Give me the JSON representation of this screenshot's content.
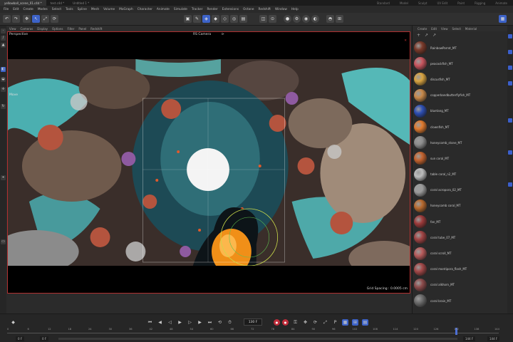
{
  "doc_tabs": [
    "yellowball_scene_01.c4d *",
    "test.c4d *",
    "Untitled 1 *"
  ],
  "layout_tabs": [
    "Standard",
    "Model",
    "Sculpt",
    "UV Edit",
    "Paint",
    "Rigging",
    "Animate"
  ],
  "menu": [
    "File",
    "Edit",
    "Create",
    "Modes",
    "Select",
    "Tools",
    "Spline",
    "Mesh",
    "Volume",
    "MoGraph",
    "Character",
    "Animate",
    "Simulate",
    "Tracker",
    "Render",
    "Extensions",
    "Octane",
    "Redshift",
    "Window",
    "Help"
  ],
  "view_menu": [
    "View",
    "Cameras",
    "Display",
    "Options",
    "Filter",
    "Panel",
    "Redshift"
  ],
  "viewport": {
    "view_name": "Perspective",
    "camera": "RS Camera",
    "mode_label": "Move",
    "grid_spacing": "Grid Spacing : 0.0005 cm"
  },
  "material_panel": {
    "menu": [
      "Create",
      "Edit",
      "View",
      "Select",
      "Material"
    ],
    "materials": [
      {
        "name": "RainbowParrot_MT",
        "color": "#7a3a2a"
      },
      {
        "name": "peacockfish_MT",
        "color": "#c9555e"
      },
      {
        "name": "discusfish_MT",
        "color": "#d9a441"
      },
      {
        "name": "copperbandbutterflyfish_MT",
        "color": "#c8894a"
      },
      {
        "name": "bluetang_MT",
        "color": "#2e4fb4"
      },
      {
        "name": "clownfish_MT",
        "color": "#e07a2e"
      },
      {
        "name": "honeycomb_stone_MT",
        "color": "#8d8d8d"
      },
      {
        "name": "sun coral_MT",
        "color": "#c4632e"
      },
      {
        "name": "table coral_n2_MT",
        "color": "#bdbdbd"
      },
      {
        "name": "coral acropora_02_MT",
        "color": "#9b9b9b"
      },
      {
        "name": "honeycomb coral_MT",
        "color": "#b96a2e"
      },
      {
        "name": "fan_MT",
        "color": "#9e3b3b"
      },
      {
        "name": "coral tube_07_MT",
        "color": "#a24444"
      },
      {
        "name": "coral scroll_MT",
        "color": "#b85b5b"
      },
      {
        "name": "coral montipora_flash_MT",
        "color": "#a24848"
      },
      {
        "name": "coral alkhorn_MT",
        "color": "#8d4b4b"
      },
      {
        "name": "coral brain_MT",
        "color": "#6c6c6c"
      }
    ]
  },
  "timeline": {
    "current_frame": "130 F",
    "ticks": [
      "0",
      "6",
      "12",
      "18",
      "24",
      "30",
      "36",
      "42",
      "48",
      "54",
      "60",
      "66",
      "72",
      "78",
      "84",
      "90",
      "96",
      "102",
      "108",
      "114",
      "120",
      "126",
      "132",
      "138",
      "144"
    ],
    "start_field": "0 F",
    "start_field2": "0 F",
    "end_field": "144 F",
    "end_field2": "144 F"
  }
}
